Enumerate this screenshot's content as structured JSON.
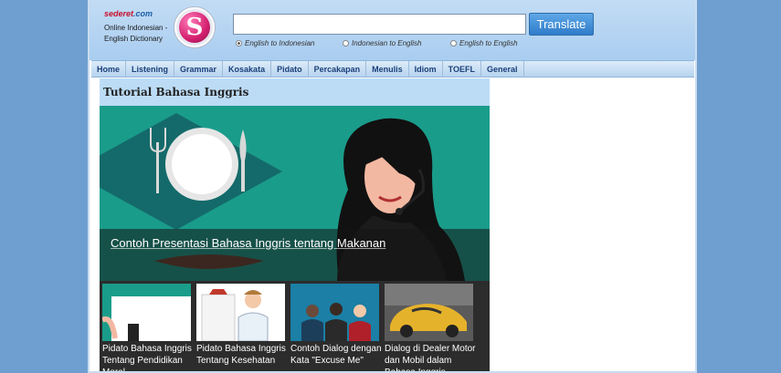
{
  "header": {
    "brand": "sederet",
    "brand_suffix": ".com",
    "tagline_line1": "Online Indonesian -",
    "tagline_line2": "English Dictionary",
    "logo_letter": "S",
    "search_value": "",
    "translate_label": "Translate",
    "radio_options": [
      {
        "label": "English to Indonesian",
        "checked": true
      },
      {
        "label": "Indonesian to English",
        "checked": false
      },
      {
        "label": "English to English",
        "checked": false
      }
    ]
  },
  "nav": {
    "items": [
      "Home",
      "Listening",
      "Grammar",
      "Kosakata",
      "Pidato",
      "Percakapan",
      "Menulis",
      "Idiom",
      "TOEFL",
      "General"
    ]
  },
  "main": {
    "section_title": "Tutorial Bahasa Inggris",
    "hero_caption": "Contoh Presentasi Bahasa Inggris tentang Makanan",
    "thumbs": [
      {
        "caption": "Pidato Bahasa Inggris Tentang Pendidikan Moral"
      },
      {
        "caption": "Pidato Bahasa Inggris Tentang Kesehatan"
      },
      {
        "caption": "Contoh Dialog dengan Kata \"Excuse Me\""
      },
      {
        "caption": "Dialog di Dealer Motor dan Mobil dalam Bahasa Inggris"
      }
    ]
  },
  "colors": {
    "page_bg": "#6e9fd0",
    "header_bg": "#a9cdf0",
    "hero_bg": "#1a9c8a",
    "brand_red": "#c8102e"
  }
}
